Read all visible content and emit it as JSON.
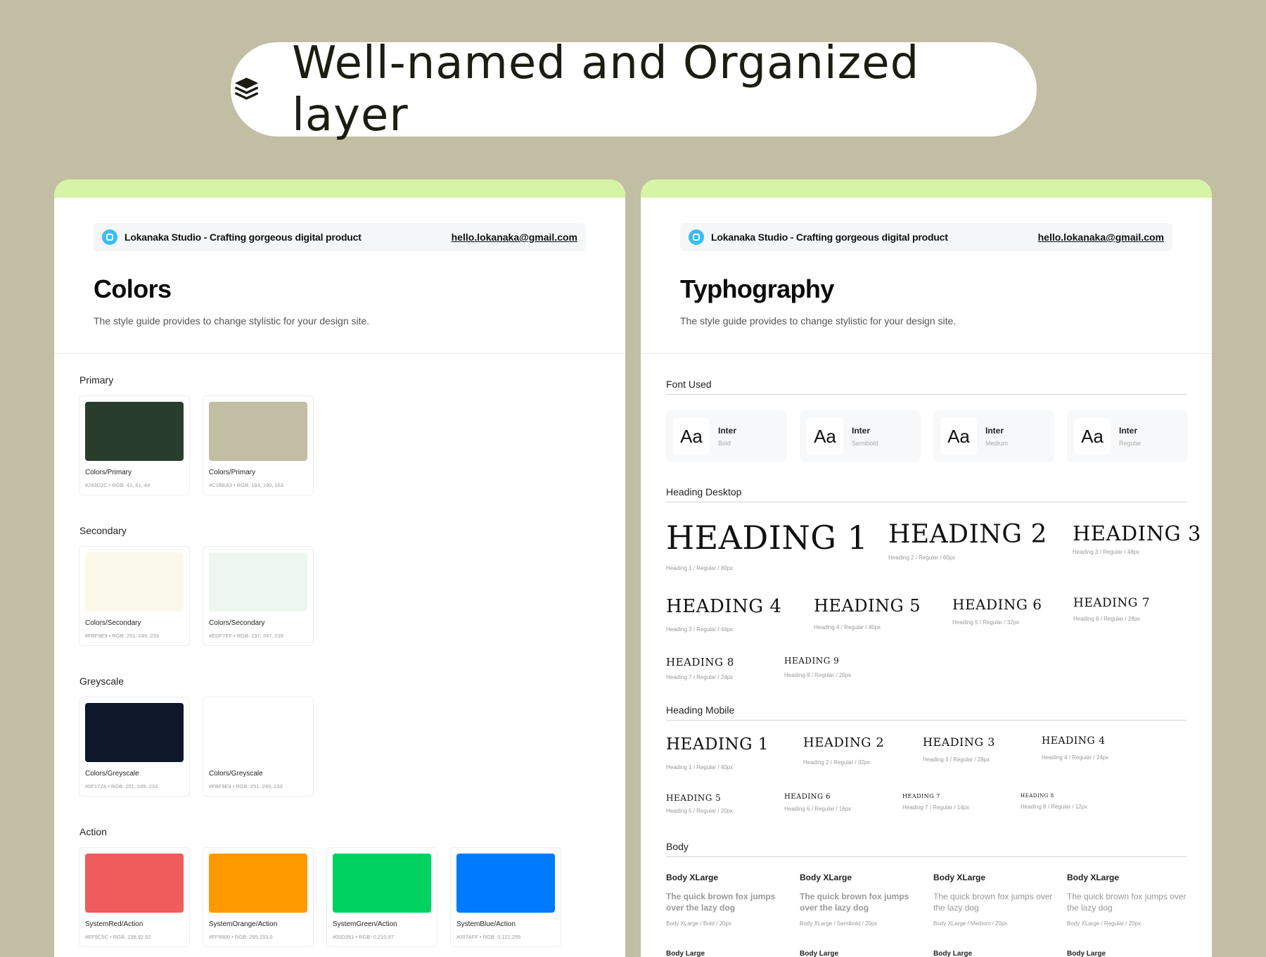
{
  "banner": {
    "title": "Well-named and Organized layer"
  },
  "header": {
    "studio": "Lokanaka Studio - Crafting gorgeous digital product",
    "email": "hello.lokanaka@gmail.com"
  },
  "colors_panel": {
    "title": "Colors",
    "subtitle": "The style guide provides to change stylistic for your design site.",
    "sections": [
      {
        "label": "Primary",
        "swatches": [
          {
            "name": "Colors/Primary",
            "meta": "#293D2C  •  RGB: 41, 61, 44",
            "color": "#293D2C"
          },
          {
            "name": "Colors/Primary",
            "meta": "#C1BEA3  •  RGB: 193, 190, 163",
            "color": "#C1BEA3"
          }
        ]
      },
      {
        "label": "Secondary",
        "swatches": [
          {
            "name": "Colors/Secondary",
            "meta": "#FBF9E9  •  RGB: 251, 249, 233",
            "color": "#FBF9E9"
          },
          {
            "name": "Colors/Secondary",
            "meta": "#EDF7EF  •  RGB: 237, 247, 239",
            "color": "#EDF7EF"
          }
        ]
      },
      {
        "label": "Greyscale",
        "swatches": [
          {
            "name": "Colors/Greyscale",
            "meta": "#0F172A  •  RGB: 251, 249, 233",
            "color": "#0F172A"
          },
          {
            "name": "Colors/Greyscale",
            "meta": "#FBF9E9  •  RGB: 251, 249, 233",
            "color": "#FFFFFF"
          }
        ]
      },
      {
        "label": "Action",
        "swatches": [
          {
            "name": "SystemRed/Action",
            "meta": "#EF5C5C  •  RGB: 239,92,92",
            "color": "#EF5C5C"
          },
          {
            "name": "SystemOrange/Action",
            "meta": "#FF9900  •  RGB: 255,153,0",
            "color": "#FF9900"
          },
          {
            "name": "SystemGreen/Action",
            "meta": "#00D261  •  RGB: 0,210,97",
            "color": "#00D261"
          },
          {
            "name": "SystemBlue/Action",
            "meta": "#007AFF  •  RGB: 0,122,255",
            "color": "#007AFF"
          }
        ]
      }
    ]
  },
  "typo_panel": {
    "title": "Typhography",
    "subtitle": "The style guide provides to change stylistic for your design site.",
    "font_used_label": "Font Used",
    "fonts": [
      {
        "aa": "Aa",
        "name": "Inter",
        "weight": "Bold"
      },
      {
        "aa": "Aa",
        "name": "Inter",
        "weight": "Semibold"
      },
      {
        "aa": "Aa",
        "name": "Inter",
        "weight": "Medium"
      },
      {
        "aa": "Aa",
        "name": "Inter",
        "weight": "Regular"
      }
    ],
    "heading_desktop_label": "Heading Desktop",
    "desktop": [
      {
        "text": "HEADING 1",
        "meta": "Heading 1 / Regular / 80px"
      },
      {
        "text": "HEADING 2",
        "meta": "Heading 2 / Regular / 60px"
      },
      {
        "text": "HEADING 3",
        "meta": "Heading 3 / Regular / 48px"
      },
      {
        "text": "HEADING 4",
        "meta": "Heading 3 / Regular / 44px"
      },
      {
        "text": "HEADING 5",
        "meta": "Heading 4 / Regular / 40px"
      },
      {
        "text": "HEADING 6",
        "meta": "Heading 5 / Regular / 32px"
      },
      {
        "text": "HEADING 7",
        "meta": "Heading 6 / Regular / 28px"
      },
      {
        "text": "HEADING 8",
        "meta": "Heading 7 / Regular / 24px"
      },
      {
        "text": "HEADING 9",
        "meta": "Heading 8 / Regular / 20px"
      }
    ],
    "heading_mobile_label": "Heading Mobile",
    "mobile": [
      {
        "text": "HEADING 1",
        "meta": "Heading 1 / Regular / 40px"
      },
      {
        "text": "HEADING 2",
        "meta": "Heading 2 / Regular / 32px"
      },
      {
        "text": "HEADING 3",
        "meta": "Heading 3 / Regular / 28px"
      },
      {
        "text": "HEADING 4",
        "meta": "Heading 4 / Regular / 24px"
      },
      {
        "text": "HEADING 5",
        "meta": "Heading 5 / Regular / 20px"
      },
      {
        "text": "HEADING 6",
        "meta": "Heading 6 / Regular / 16px"
      },
      {
        "text": "HEADING 7",
        "meta": "Heading 7 / Regular / 14px"
      },
      {
        "text": "HEADING 8",
        "meta": "Heading 8 / Regular / 12px"
      }
    ],
    "body_label": "Body",
    "body": [
      {
        "title": "Body XLarge",
        "sample": "The quick brown fox jumps over the lazy dog",
        "meta": "Body XLarge / Bold / 20px",
        "next": "Body Large"
      },
      {
        "title": "Body XLarge",
        "sample": "The quick brown fox jumps over the lazy dog",
        "meta": "Body XLarge / Semibold / 20px",
        "next": "Body Large"
      },
      {
        "title": "Body XLarge",
        "sample": "The quick brown fox jumps over the lazy dog",
        "meta": "Body XLarge / Medium / 20px",
        "next": "Body Large"
      },
      {
        "title": "Body XLarge",
        "sample": "The quick brown fox jumps over the lazy dog",
        "meta": "Body XLarge / Regular / 20px",
        "next": "Body Large"
      }
    ]
  }
}
